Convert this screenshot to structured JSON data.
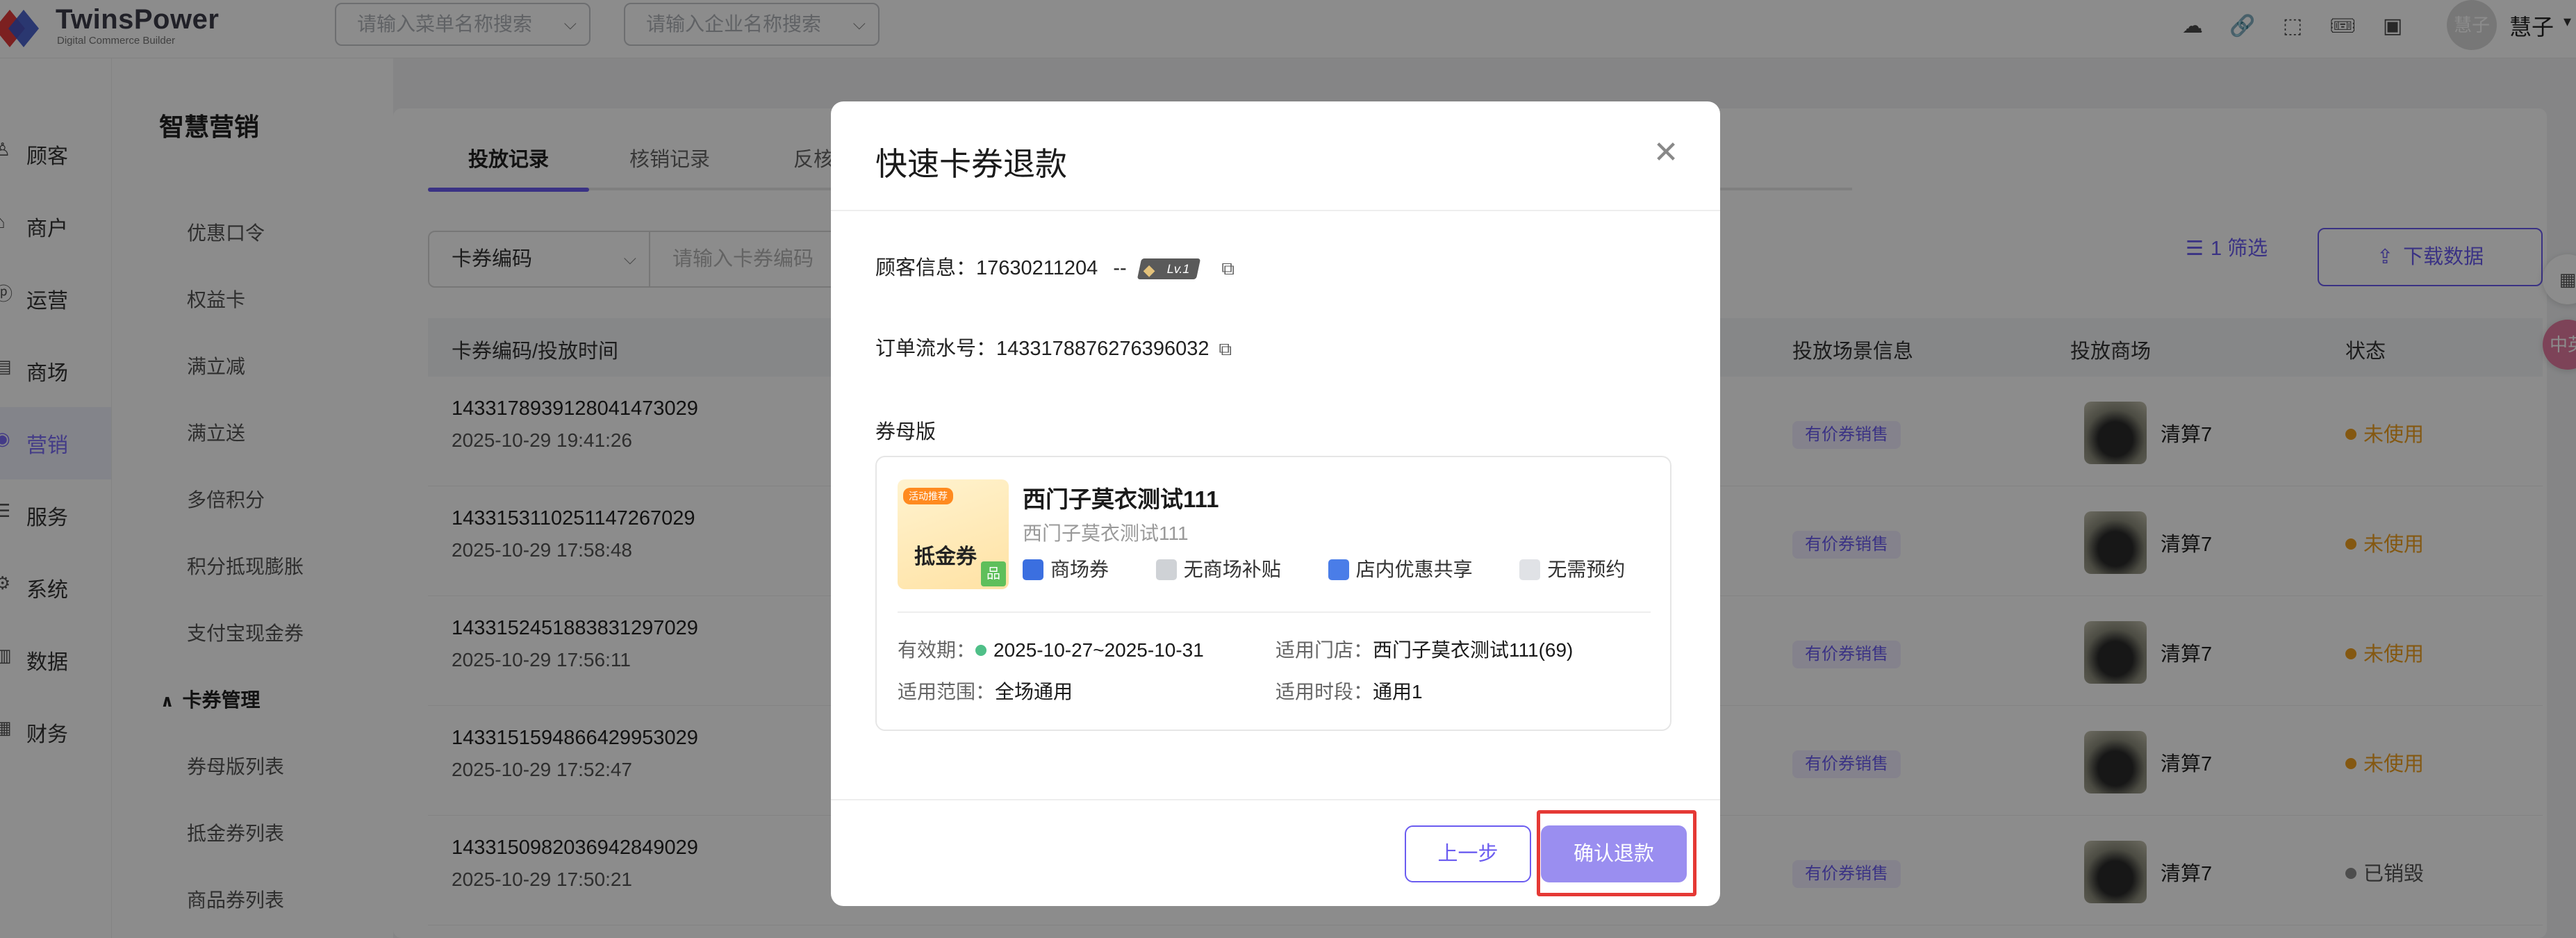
{
  "app": {
    "brand": "TwinsPower",
    "brand_sub": "Digital Commerce Builder",
    "menu_search_placeholder": "请输入菜单名称搜索",
    "company_search_placeholder": "请输入企业名称搜索",
    "avatar_text": "慧子",
    "user_name": "慧子",
    "icons": [
      "cloud-upload-icon",
      "link-icon",
      "cube-icon",
      "ticket-icon",
      "id-card-icon"
    ]
  },
  "left_nav": [
    {
      "label": "顾客",
      "icon": "customer-icon"
    },
    {
      "label": "商户",
      "icon": "merchant-icon"
    },
    {
      "label": "运营",
      "icon": "operation-icon"
    },
    {
      "label": "商场",
      "icon": "mall-icon"
    },
    {
      "label": "营销",
      "icon": "marketing-icon",
      "active": true
    },
    {
      "label": "服务",
      "icon": "service-icon"
    },
    {
      "label": "系统",
      "icon": "system-icon"
    },
    {
      "label": "数据",
      "icon": "data-icon"
    },
    {
      "label": "财务",
      "icon": "finance-icon"
    }
  ],
  "sub_nav": {
    "title": "智慧营销",
    "items": [
      "优惠口令",
      "权益卡",
      "满立减",
      "满立送",
      "多倍积分",
      "积分抵现膨胀",
      "支付宝现金券"
    ],
    "group": "卡券管理",
    "group_items": [
      "券母版列表",
      "抵金券列表",
      "商品券列表"
    ]
  },
  "main": {
    "tabs": [
      "投放记录",
      "核销记录",
      "反核"
    ],
    "filter_field": "卡券编码",
    "filter_placeholder": "请输入卡券编码",
    "filter_button": "1 筛选",
    "download_button": "下载数据",
    "columns": [
      "卡券编码/投放时间",
      "投放场景信息",
      "投放商场",
      "状态"
    ],
    "rows": [
      {
        "code": "1433178939128041473029",
        "time": "2025-10-29 19:41:26",
        "scene": "有价券销售",
        "shop": "清算7",
        "status": "未使用"
      },
      {
        "code": "1433153110251147267029",
        "time": "2025-10-29 17:58:48",
        "scene": "有价券销售",
        "shop": "清算7",
        "status": "未使用"
      },
      {
        "code": "1433152451883831297029",
        "time": "2025-10-29 17:56:11",
        "scene": "有价券销售",
        "shop": "清算7",
        "status": "未使用"
      },
      {
        "code": "1433151594866429953029",
        "time": "2025-10-29 17:52:47",
        "scene": "有价券销售",
        "shop": "清算7",
        "status": "未使用"
      },
      {
        "code": "1433150982036942849029",
        "time": "2025-10-29 17:50:21",
        "scene": "有价券销售",
        "shop": "清算7",
        "status": "已销毁"
      }
    ]
  },
  "floaters": [
    "apps-icon",
    "translate-icon"
  ],
  "floater_labels": [
    "",
    "中英"
  ],
  "modal": {
    "title": "快速卡券退款",
    "customer_label": "顾客信息：",
    "customer_phone": "17630211204",
    "customer_sep": "--",
    "level": "Lv.1",
    "order_label": "订单流水号：",
    "order_no": "1433178876276396032",
    "section_label": "券母版",
    "coupon": {
      "img_tag": "活动推荐",
      "img_text": "抵金券",
      "img_stamp": "品",
      "name": "西门子莫衣测试111",
      "sub": "西门子莫衣测试111",
      "tags": [
        "商场券",
        "无商场补贴",
        "店内优惠共享",
        "无需预约"
      ],
      "validity_label": "有效期：",
      "validity": "2025-10-27~2025-10-31",
      "store_label": "适用门店：",
      "store": "西门子莫衣测试111(69)",
      "scope_label": "适用范围：",
      "scope": "全场通用",
      "period_label": "适用时段：",
      "period": "通用1"
    },
    "prev_button": "上一步",
    "confirm_button": "确认退款"
  },
  "colors": {
    "accent": "#6b5cf0",
    "warning": "#f0a020",
    "muted": "#8c8c8c",
    "highlight": "#e53935"
  }
}
